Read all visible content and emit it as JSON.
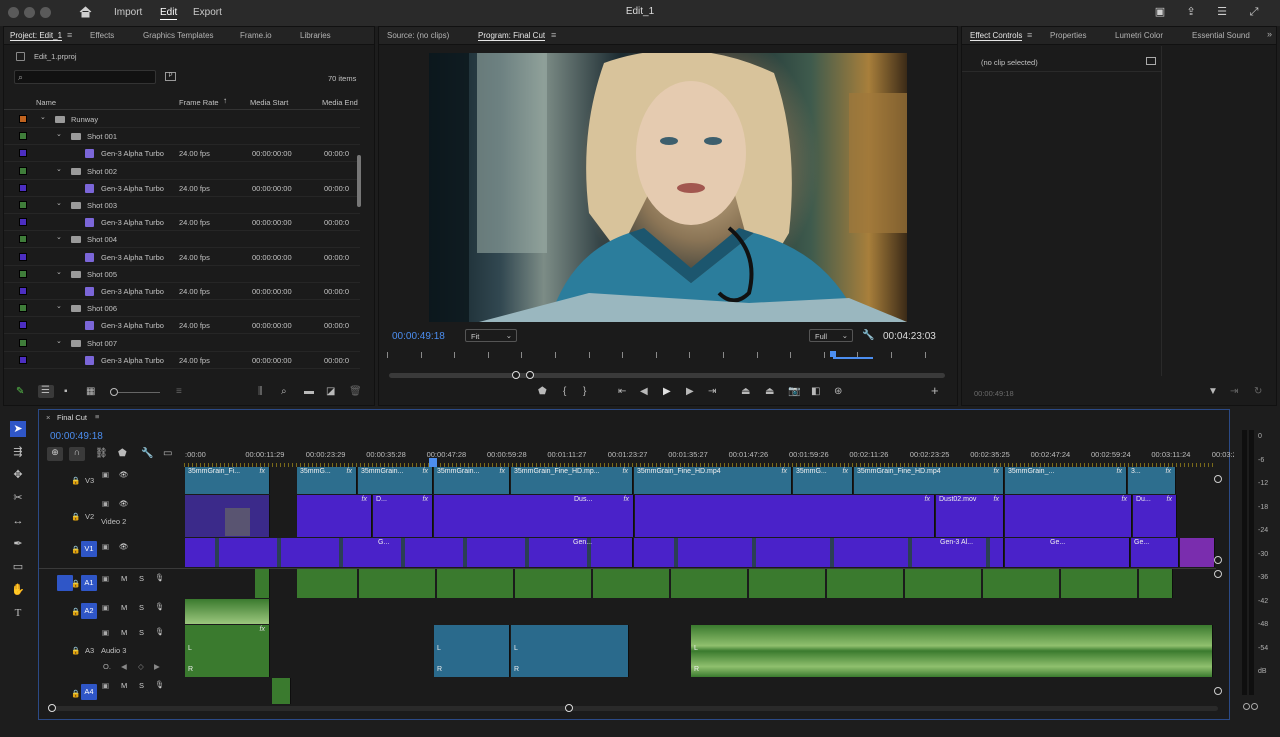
{
  "menu": {
    "home_icon": "home-icon",
    "import": "Import",
    "edit": "Edit",
    "export": "Export"
  },
  "window_title": "Edit_1",
  "project_panel": {
    "tabs": [
      "Project: Edit_1",
      "Effects",
      "Graphics Templates",
      "Frame.io",
      "Libraries"
    ],
    "file": "Edit_1.prproj",
    "search_placeholder": "",
    "items_count": "70 items",
    "columns": [
      "Name",
      "Frame Rate",
      "Media Start",
      "Media End"
    ],
    "rows": [
      {
        "type": "folder",
        "name": "Runway",
        "color": "#c0631f"
      },
      {
        "type": "subfolder",
        "name": "Shot 001",
        "color": "#3f7d3a"
      },
      {
        "type": "clip",
        "name": "Gen-3 Alpha Turbo",
        "fps": "24.00 fps",
        "start": "00:00:00:00",
        "end": "00:00:0",
        "color": "#4c2ec1"
      },
      {
        "type": "subfolder",
        "name": "Shot 002",
        "color": "#3f7d3a"
      },
      {
        "type": "clip",
        "name": "Gen-3 Alpha Turbo",
        "fps": "24.00 fps",
        "start": "00:00:00:00",
        "end": "00:00:0",
        "color": "#4c2ec1"
      },
      {
        "type": "subfolder",
        "name": "Shot 003",
        "color": "#3f7d3a"
      },
      {
        "type": "clip",
        "name": "Gen-3 Alpha Turbo",
        "fps": "24.00 fps",
        "start": "00:00:00:00",
        "end": "00:00:0",
        "color": "#4c2ec1"
      },
      {
        "type": "subfolder",
        "name": "Shot 004",
        "color": "#3f7d3a"
      },
      {
        "type": "clip",
        "name": "Gen-3 Alpha Turbo",
        "fps": "24.00 fps",
        "start": "00:00:00:00",
        "end": "00:00:0",
        "color": "#4c2ec1"
      },
      {
        "type": "subfolder",
        "name": "Shot 005",
        "color": "#3f7d3a"
      },
      {
        "type": "clip",
        "name": "Gen-3 Alpha Turbo",
        "fps": "24.00 fps",
        "start": "00:00:00:00",
        "end": "00:00:0",
        "color": "#4c2ec1"
      },
      {
        "type": "subfolder",
        "name": "Shot 006",
        "color": "#3f7d3a"
      },
      {
        "type": "clip",
        "name": "Gen-3 Alpha Turbo",
        "fps": "24.00 fps",
        "start": "00:00:00:00",
        "end": "00:00:0",
        "color": "#4c2ec1"
      },
      {
        "type": "subfolder",
        "name": "Shot 007",
        "color": "#3f7d3a"
      },
      {
        "type": "clip",
        "name": "Gen-3 Alpha Turbo",
        "fps": "24.00 fps",
        "start": "00:00:00:00",
        "end": "00:00:0",
        "color": "#4c2ec1"
      }
    ]
  },
  "monitor": {
    "source_tab": "Source: (no clips)",
    "program_tab": "Program: Final Cut",
    "current_time": "00:00:49:18",
    "fit": "Fit",
    "quality": "Full",
    "duration": "00:04:23:03"
  },
  "effect_controls": {
    "tabs": [
      "Effect Controls",
      "Properties",
      "Lumetri Color",
      "Essential Sound"
    ],
    "no_clip": "(no clip selected)",
    "time": "00:00:49:18"
  },
  "timeline": {
    "sequence_name": "Final Cut",
    "current_time": "00:00:49:18",
    "ruler_labels": [
      ":00:00",
      "00:00:11:29",
      "00:00:23:29",
      "00:00:35:28",
      "00:00:47:28",
      "00:00:59:28",
      "00:01:11:27",
      "00:01:23:27",
      "00:01:35:27",
      "00:01:47:26",
      "00:01:59:26",
      "00:02:11:26",
      "00:02:23:25",
      "00:02:35:25",
      "00:02:47:24",
      "00:02:59:24",
      "00:03:11:24",
      "00:03:2"
    ],
    "tracks": {
      "v3": "V3",
      "v2": "V2",
      "v2_name": "Video 2",
      "v1": "V1",
      "a1": "A1",
      "a2": "A2",
      "a3": "A3",
      "a3_name": "Audio 3",
      "a4": "A4",
      "m": "M",
      "s": "S"
    },
    "clip_names": {
      "v3_1": "35mmGrain_Fi...",
      "v3_2": "35mmG...",
      "v3_3": "35mmGrain...",
      "v3_4": "35mmGrain...",
      "v3_5": "35mmGrain_Fine_HD.mp...",
      "v3_6": "35mmGrain_Fine_HD.mp4",
      "v3_7": "35mmGrain_...",
      "v3_8": "35mmG...",
      "v3_9": "35mmGrain_Fine_HD.mp4",
      "v3_10": "35mmGrain_...",
      "v3_11": "3...",
      "v2_1": "D...",
      "v2_2": "Dus...",
      "v2_3": "Dust02.mov",
      "v2_4": "Du...",
      "v1_1": "G...",
      "v1_2": "Gen...",
      "v1_3": "Gen-3 Al...",
      "v1_4": "Ge...",
      "v1_5": "Ge...",
      "r": "R",
      "l": "L"
    },
    "meter_labels": [
      "0",
      "-6",
      "-12",
      "-18",
      "-24",
      "-30",
      "-36",
      "-42",
      "-48",
      "-54",
      "dB"
    ]
  }
}
